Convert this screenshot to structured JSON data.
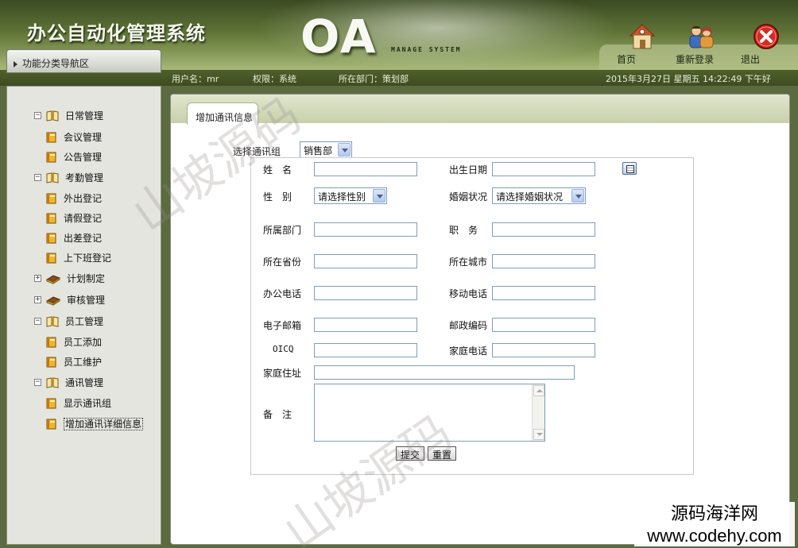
{
  "header": {
    "app_title": "办公自动化管理系统",
    "logo_text": "OA",
    "logo_sub": "MANAGE SYSTEM",
    "buttons": {
      "home": "首页",
      "relogin": "重新登录",
      "exit": "退出"
    }
  },
  "infobar": {
    "username": "用户名：mr",
    "role": "权限：系统",
    "dept": "所在部门：策划部",
    "datetime": "2015年3月27日 星期五 14:22:49 下午好"
  },
  "sidebar": {
    "header": "功能分类导航区",
    "items": [
      {
        "label": "日常管理",
        "level": 0,
        "toggle": "−",
        "icon": "open-book-icon"
      },
      {
        "label": "会议管理",
        "level": 1,
        "icon": "book-icon"
      },
      {
        "label": "公告管理",
        "level": 1,
        "icon": "book-icon"
      },
      {
        "label": "考勤管理",
        "level": 0,
        "toggle": "−",
        "icon": "open-book-icon"
      },
      {
        "label": "外出登记",
        "level": 1,
        "icon": "book-icon"
      },
      {
        "label": "请假登记",
        "level": 1,
        "icon": "book-icon"
      },
      {
        "label": "出差登记",
        "level": 1,
        "icon": "book-icon"
      },
      {
        "label": "上下班登记",
        "level": 1,
        "icon": "book-icon"
      },
      {
        "label": "计划制定",
        "level": 0,
        "toggle": "+",
        "icon": "closed-book-icon"
      },
      {
        "label": "审核管理",
        "level": 0,
        "toggle": "+",
        "icon": "closed-book-icon"
      },
      {
        "label": "员工管理",
        "level": 0,
        "toggle": "−",
        "icon": "open-book-icon"
      },
      {
        "label": "员工添加",
        "level": 1,
        "icon": "book-icon"
      },
      {
        "label": "员工维护",
        "level": 1,
        "icon": "book-icon"
      },
      {
        "label": "通讯管理",
        "level": 0,
        "toggle": "−",
        "icon": "open-book-icon"
      },
      {
        "label": "显示通讯组",
        "level": 1,
        "icon": "book-icon"
      },
      {
        "label": "增加通讯详细信息",
        "level": 1,
        "icon": "book-icon",
        "selected": true
      }
    ]
  },
  "main": {
    "tab_label": "增加通讯信息",
    "group_label": "选择通讯组",
    "group_value": "销售部",
    "fields": {
      "name": "姓　名",
      "birthday": "出生日期",
      "gender": "性　别",
      "gender_value": "请选择性别",
      "marital": "婚姻状况",
      "marital_value": "请选择婚姻状况",
      "department": "所属部门",
      "position": "职　务",
      "province": "所在省份",
      "city": "所在城市",
      "office_phone": "办公电话",
      "mobile_phone": "移动电话",
      "email": "电子邮箱",
      "postcode": "邮政编码",
      "oicq": "OICQ",
      "home_phone": "家庭电话",
      "address": "家庭住址",
      "remark": "备　注"
    },
    "submit_label": "提交",
    "reset_label": "重置"
  },
  "watermarks": {
    "text": "山坡源码",
    "brand_cn": "源码海洋网",
    "brand_url": "www.codehy.com"
  }
}
